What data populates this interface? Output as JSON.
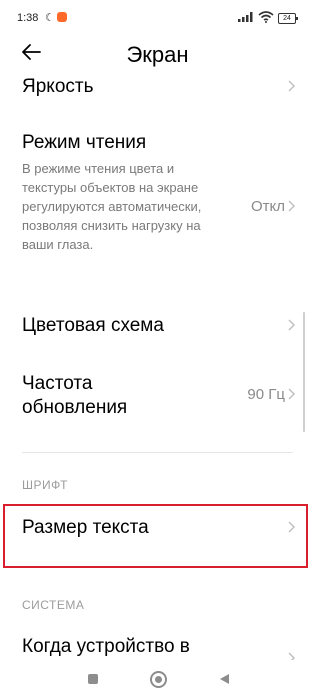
{
  "status_bar": {
    "time": "1:38",
    "battery": "24"
  },
  "header": {
    "title": "Экран"
  },
  "items": [
    {
      "title": "Яркость"
    },
    {
      "title": "Режим чтения",
      "description": "В режиме чтения цвета и текстуры объектов на экране регулируются автоматически, позволяя снизить нагрузку на ваши глаза.",
      "value": "Откл"
    },
    {
      "title": "Цветовая схема"
    },
    {
      "title": "Частота обновления",
      "value": "90 Гц"
    },
    {
      "title": "Размер текста"
    },
    {
      "title": "Когда устройство в"
    }
  ],
  "sections": {
    "font": "ШРИФТ",
    "system": "СИСТЕМА"
  },
  "colors": {
    "highlight": "#d91e2e",
    "app_icon": "#ff6a2a"
  }
}
